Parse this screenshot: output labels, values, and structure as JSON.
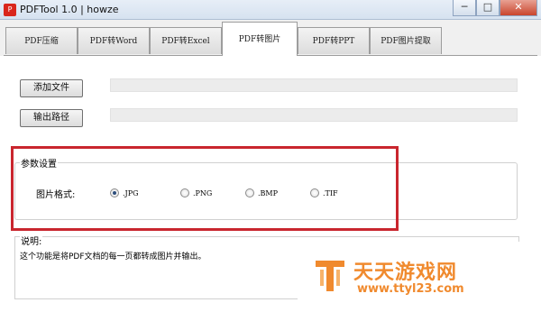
{
  "window": {
    "title": "PDFTool 1.0 | howze",
    "minimize": "─",
    "maximize": "□",
    "close": "✕"
  },
  "tabs": [
    {
      "label": "PDF压缩",
      "active": false
    },
    {
      "label": "PDF转Word",
      "active": false
    },
    {
      "label": "PDF转Excel",
      "active": false
    },
    {
      "label": "PDF转图片",
      "active": true
    },
    {
      "label": "PDF转PPT",
      "active": false
    },
    {
      "label": "PDF图片提取",
      "active": false
    }
  ],
  "actions": {
    "add_file": "添加文件",
    "output_path": "输出路径"
  },
  "settings": {
    "group_title": "参数设置",
    "format_label": "图片格式:",
    "formats": [
      {
        "label": ".JPG",
        "checked": true
      },
      {
        "label": ".PNG",
        "checked": false
      },
      {
        "label": ".BMP",
        "checked": false
      },
      {
        "label": ".TIF",
        "checked": false
      }
    ]
  },
  "description": {
    "title": "说明:",
    "text": "这个功能是将PDF文档的每一页都转成图片并输出。"
  },
  "watermark": {
    "brand": "天天游戏网",
    "url": "www.ttyl23.com"
  },
  "colors": {
    "highlight": "#c9262e",
    "watermark": "#f08a2e"
  }
}
